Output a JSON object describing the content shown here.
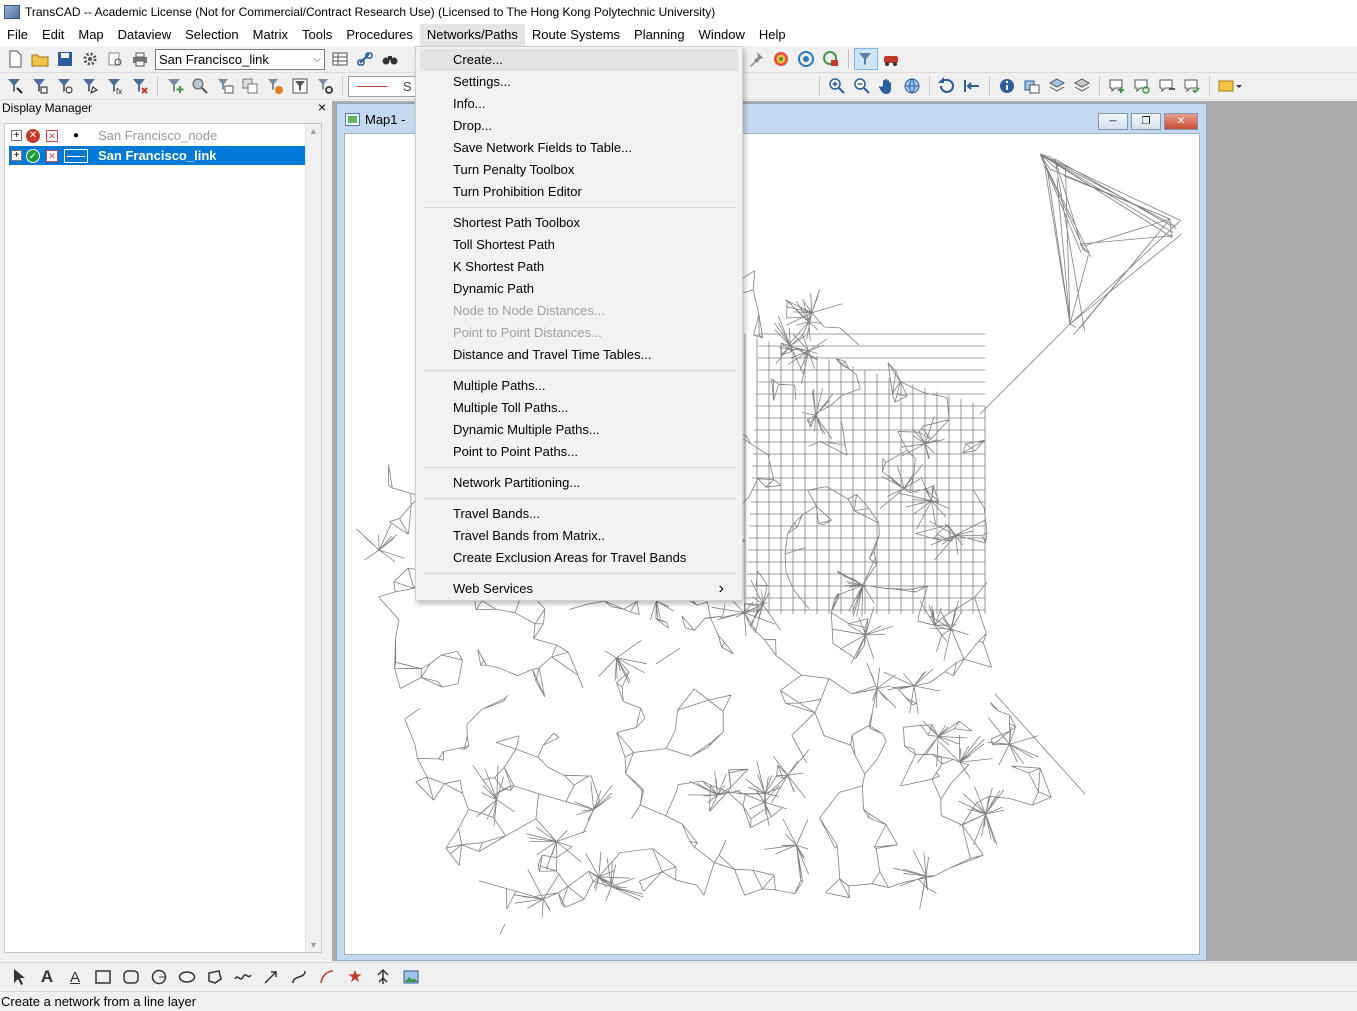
{
  "window": {
    "title": "TransCAD -- Academic License (Not for Commercial/Contract Research Use) (Licensed to The Hong Kong Polytechnic University)"
  },
  "menubar": {
    "items": [
      {
        "label": "File"
      },
      {
        "label": "Edit"
      },
      {
        "label": "Map"
      },
      {
        "label": "Dataview"
      },
      {
        "label": "Selection"
      },
      {
        "label": "Matrix"
      },
      {
        "label": "Tools"
      },
      {
        "label": "Procedures"
      },
      {
        "label": "Networks/Paths"
      },
      {
        "label": "Route Systems"
      },
      {
        "label": "Planning"
      },
      {
        "label": "Window"
      },
      {
        "label": "Help"
      }
    ],
    "active_item": "Networks/Paths"
  },
  "toolbar": {
    "layer_select_value": "San Francisco_link",
    "style_box_text": "S"
  },
  "display_manager": {
    "title": "Display Manager",
    "close": "×",
    "layers": [
      {
        "name": "San Francisco_node",
        "visible": false,
        "selected": false
      },
      {
        "name": "San Francisco_link",
        "visible": true,
        "selected": true
      }
    ]
  },
  "map_window": {
    "title": "Map1 -",
    "line_color": "#808080"
  },
  "networks_menu": {
    "groups": [
      [
        {
          "label": "Create...",
          "enabled": true,
          "highlighted": true
        },
        {
          "label": "Settings...",
          "enabled": true
        },
        {
          "label": "Info...",
          "enabled": true
        },
        {
          "label": "Drop...",
          "enabled": true
        },
        {
          "label": "Save Network Fields to Table...",
          "enabled": true
        },
        {
          "label": "Turn Penalty Toolbox",
          "enabled": true
        },
        {
          "label": "Turn Prohibition Editor",
          "enabled": true
        }
      ],
      [
        {
          "label": "Shortest Path Toolbox",
          "enabled": true
        },
        {
          "label": "Toll Shortest Path",
          "enabled": true
        },
        {
          "label": "K Shortest Path",
          "enabled": true
        },
        {
          "label": "Dynamic Path",
          "enabled": true
        },
        {
          "label": "Node to Node Distances...",
          "enabled": false
        },
        {
          "label": "Point to Point Distances...",
          "enabled": false
        },
        {
          "label": "Distance and Travel Time Tables...",
          "enabled": true
        }
      ],
      [
        {
          "label": "Multiple Paths...",
          "enabled": true
        },
        {
          "label": "Multiple Toll Paths...",
          "enabled": true
        },
        {
          "label": "Dynamic Multiple Paths...",
          "enabled": true
        },
        {
          "label": "Point to Point Paths...",
          "enabled": true
        }
      ],
      [
        {
          "label": "Network Partitioning...",
          "enabled": true
        }
      ],
      [
        {
          "label": "Travel Bands...",
          "enabled": true
        },
        {
          "label": "Travel Bands from Matrix..",
          "enabled": true
        },
        {
          "label": "Create Exclusion Areas for Travel Bands",
          "enabled": true
        }
      ],
      [
        {
          "label": "Web Services",
          "enabled": true,
          "submenu": true
        }
      ]
    ]
  },
  "status": {
    "text": "Create a network from a line layer"
  },
  "colors": {
    "selection": "#0078d7",
    "mdi_background": "#ababab",
    "map_frame": "#c4d8ef"
  }
}
